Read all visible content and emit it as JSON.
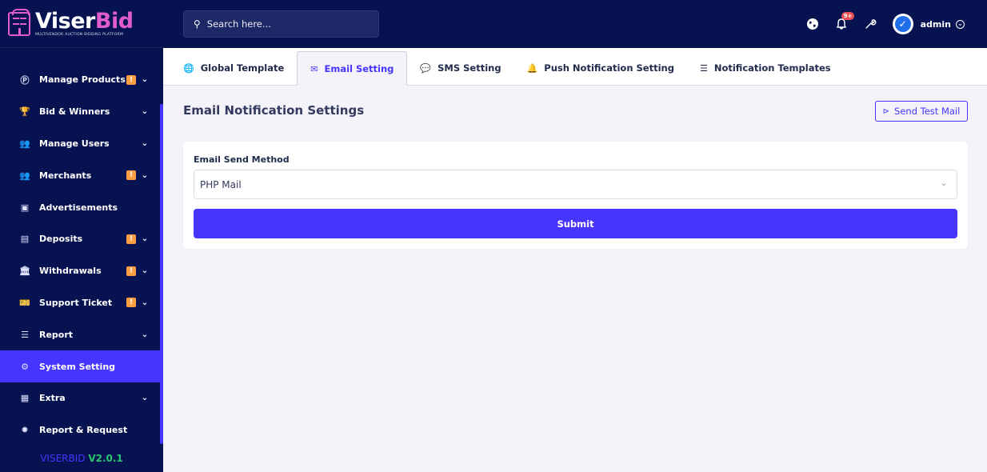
{
  "brand": {
    "name_main": "Viser",
    "name_accent": "Bid",
    "tagline": "MULTIVENDOR AUCTION BIDDING PLATFORM",
    "logo_icon": "store-icon"
  },
  "sidebar": {
    "items": [
      {
        "label": "Manage Products",
        "icon": "product-icon",
        "glyph": "Ⓟ",
        "badge": "!",
        "chevron": "⌄",
        "active": false
      },
      {
        "label": "Bid & Winners",
        "icon": "trophy-icon",
        "glyph": "🏆",
        "badge": "",
        "chevron": "⌄",
        "active": false
      },
      {
        "label": "Manage Users",
        "icon": "users-icon",
        "glyph": "👥",
        "badge": "",
        "chevron": "⌄",
        "active": false
      },
      {
        "label": "Merchants",
        "icon": "merchants-icon",
        "glyph": "👥",
        "badge": "!",
        "chevron": "⌄",
        "active": false
      },
      {
        "label": "Advertisements",
        "icon": "ad-icon",
        "glyph": "▣",
        "badge": "",
        "chevron": "",
        "active": false
      },
      {
        "label": "Deposits",
        "icon": "deposit-icon",
        "glyph": "▤",
        "badge": "!",
        "chevron": "⌄",
        "active": false
      },
      {
        "label": "Withdrawals",
        "icon": "bank-icon",
        "glyph": "🏛",
        "badge": "!",
        "chevron": "⌄",
        "active": false
      },
      {
        "label": "Support Ticket",
        "icon": "ticket-icon",
        "glyph": "🎫",
        "badge": "!",
        "chevron": "⌄",
        "active": false
      },
      {
        "label": "Report",
        "icon": "list-icon",
        "glyph": "☰",
        "badge": "",
        "chevron": "⌄",
        "active": false
      },
      {
        "label": "System Setting",
        "icon": "gear-icon",
        "glyph": "⚙",
        "badge": "",
        "chevron": "",
        "active": true
      },
      {
        "label": "Extra",
        "icon": "extra-icon",
        "glyph": "▦",
        "badge": "",
        "chevron": "⌄",
        "active": false
      },
      {
        "label": "Report & Request",
        "icon": "bug-icon",
        "glyph": "✹",
        "badge": "",
        "chevron": "",
        "active": false
      }
    ],
    "version_name": "VISERBID",
    "version_number": "V2.0.1"
  },
  "topbar": {
    "search_placeholder": "Search here...",
    "notification_count": "9+",
    "username": "admin"
  },
  "tabs": [
    {
      "label": "Global Template",
      "icon": "globe-icon",
      "glyph": "🌐",
      "active": false
    },
    {
      "label": "Email Setting",
      "icon": "envelope-icon",
      "glyph": "✉",
      "active": true
    },
    {
      "label": "SMS Setting",
      "icon": "chat-icon",
      "glyph": "💬",
      "active": false
    },
    {
      "label": "Push Notification Setting",
      "icon": "bell-icon",
      "glyph": "🔔",
      "active": false
    },
    {
      "label": "Notification Templates",
      "icon": "list-icon",
      "glyph": "☰",
      "active": false
    }
  ],
  "main": {
    "title": "Email Notification Settings",
    "test_mail_label": "Send Test Mail",
    "form": {
      "method_label": "Email Send Method",
      "method_value": "PHP Mail",
      "submit_label": "Submit"
    }
  },
  "colors": {
    "primary": "#4634ff",
    "sidebar_bg": "#071251",
    "badge_warning": "#ff9f43",
    "version_green": "#28c76f",
    "brand_pink": "#e05ad0"
  }
}
